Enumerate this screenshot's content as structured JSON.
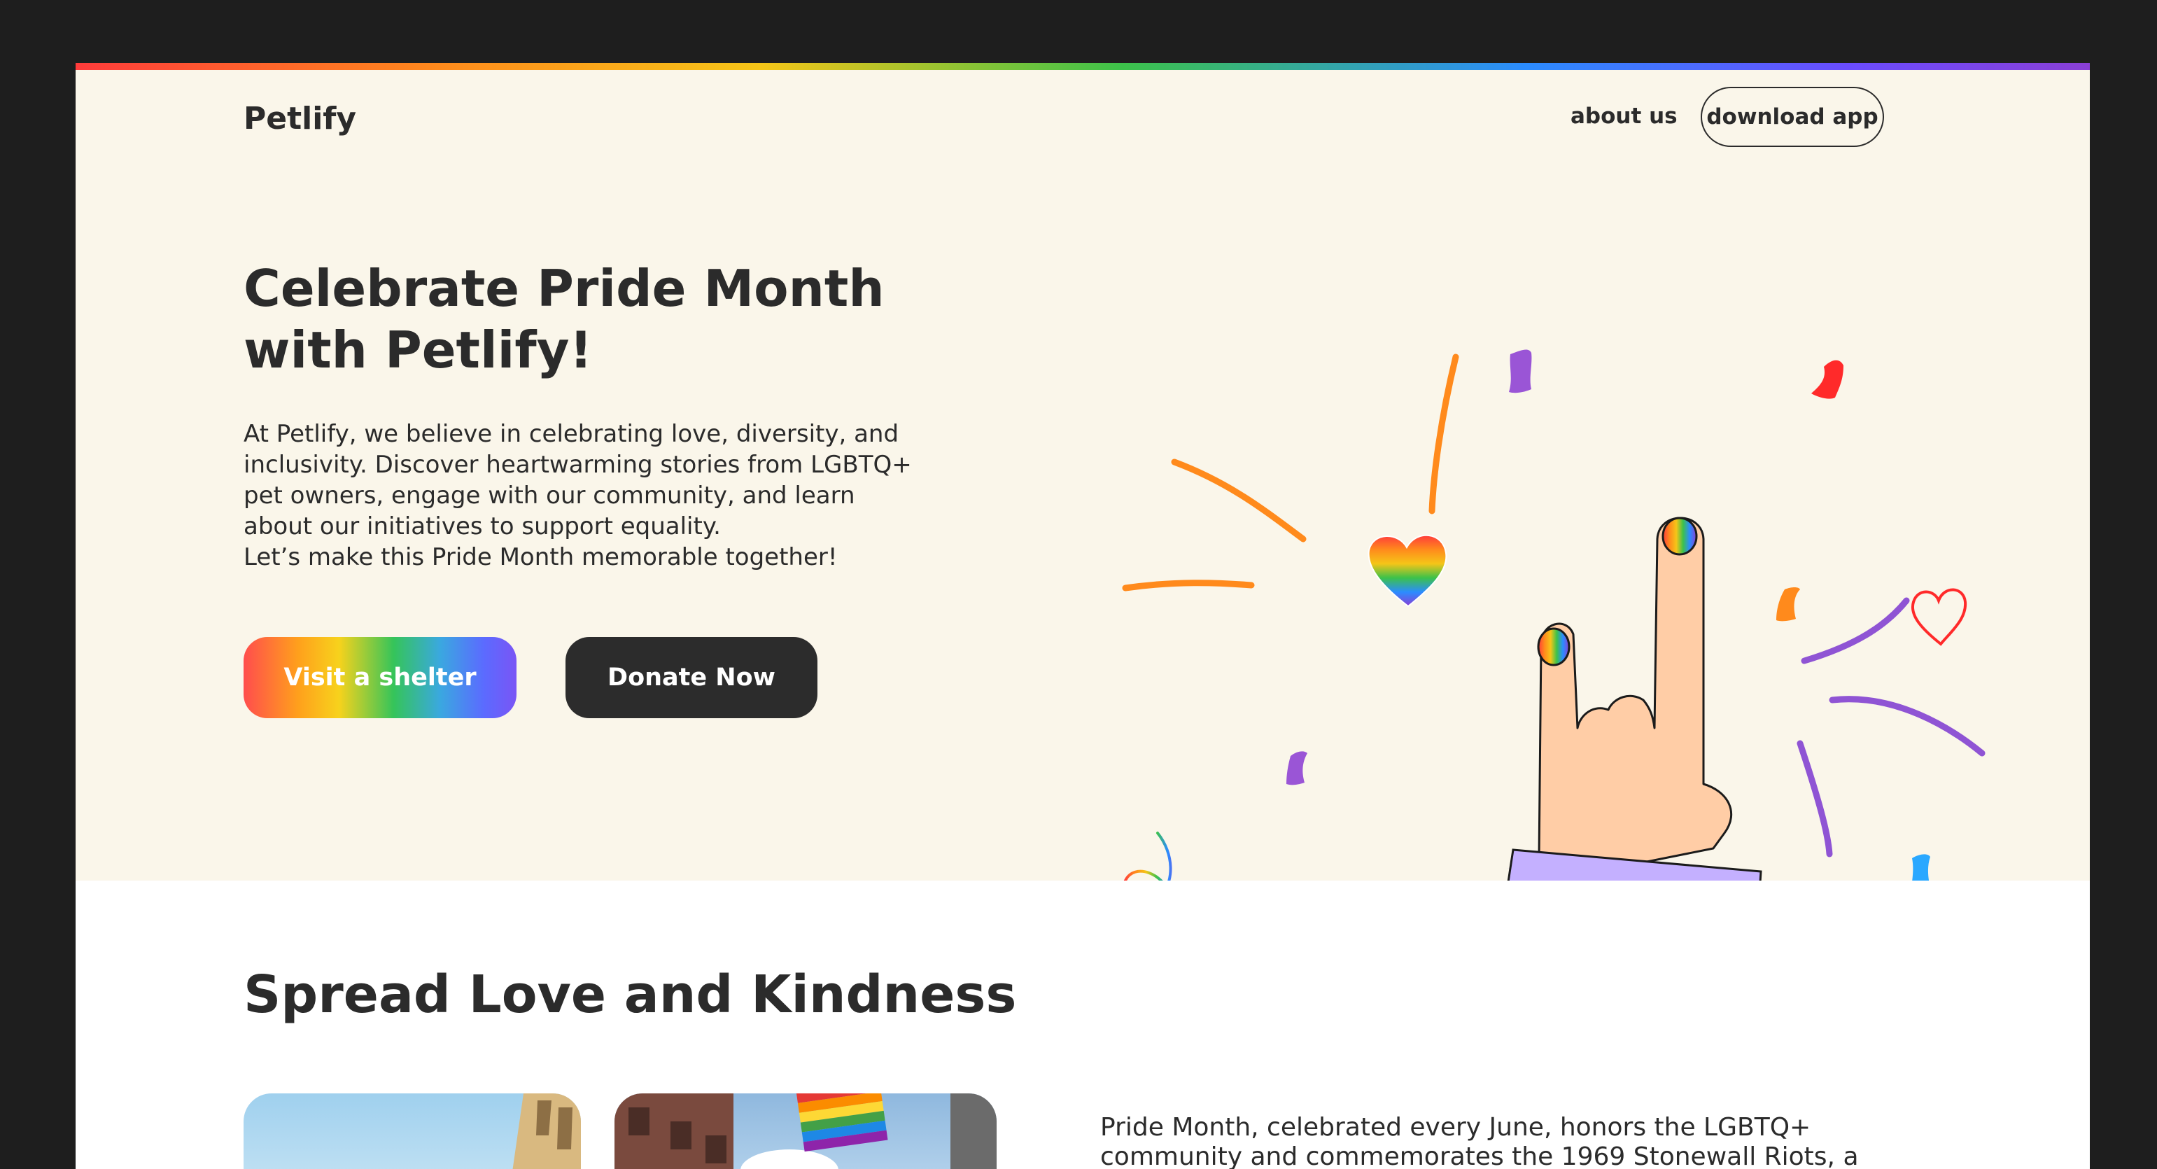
{
  "header": {
    "logo": "Petlify",
    "nav_about": "about us",
    "nav_download": "download app"
  },
  "hero": {
    "title_line1": "Celebrate Pride Month",
    "title_line2": "with Petlify!",
    "text_lines": [
      "At Petlify, we believe in celebrating love, diversity, and",
      "inclusivity. Discover heartwarming stories from LGBTQ+",
      "pet owners, engage with our community, and learn",
      "about our initiatives to support equality.",
      "Let’s make this Pride Month memorable together!"
    ],
    "btn_shelter": "Visit a shelter",
    "btn_donate": "Donate Now"
  },
  "section": {
    "title": "Spread Love and Kindness",
    "text_lines": [
      "Pride Month, celebrated every June, honors the LGBTQ+",
      "community and commemorates the 1969 Stonewall Riots, a"
    ]
  },
  "colors": {
    "page_bg": "#1e1e1e",
    "hero_bg": "#faf6ea",
    "text": "#2b2b2b",
    "sleeve": "#a080ff",
    "cuff": "#c4b0ff",
    "skin": "#ffcda6"
  },
  "icons": [
    "rainbow-heart-icon",
    "heart-outline-icon",
    "curly-arrow-icon",
    "rock-on-hand-illustration"
  ]
}
